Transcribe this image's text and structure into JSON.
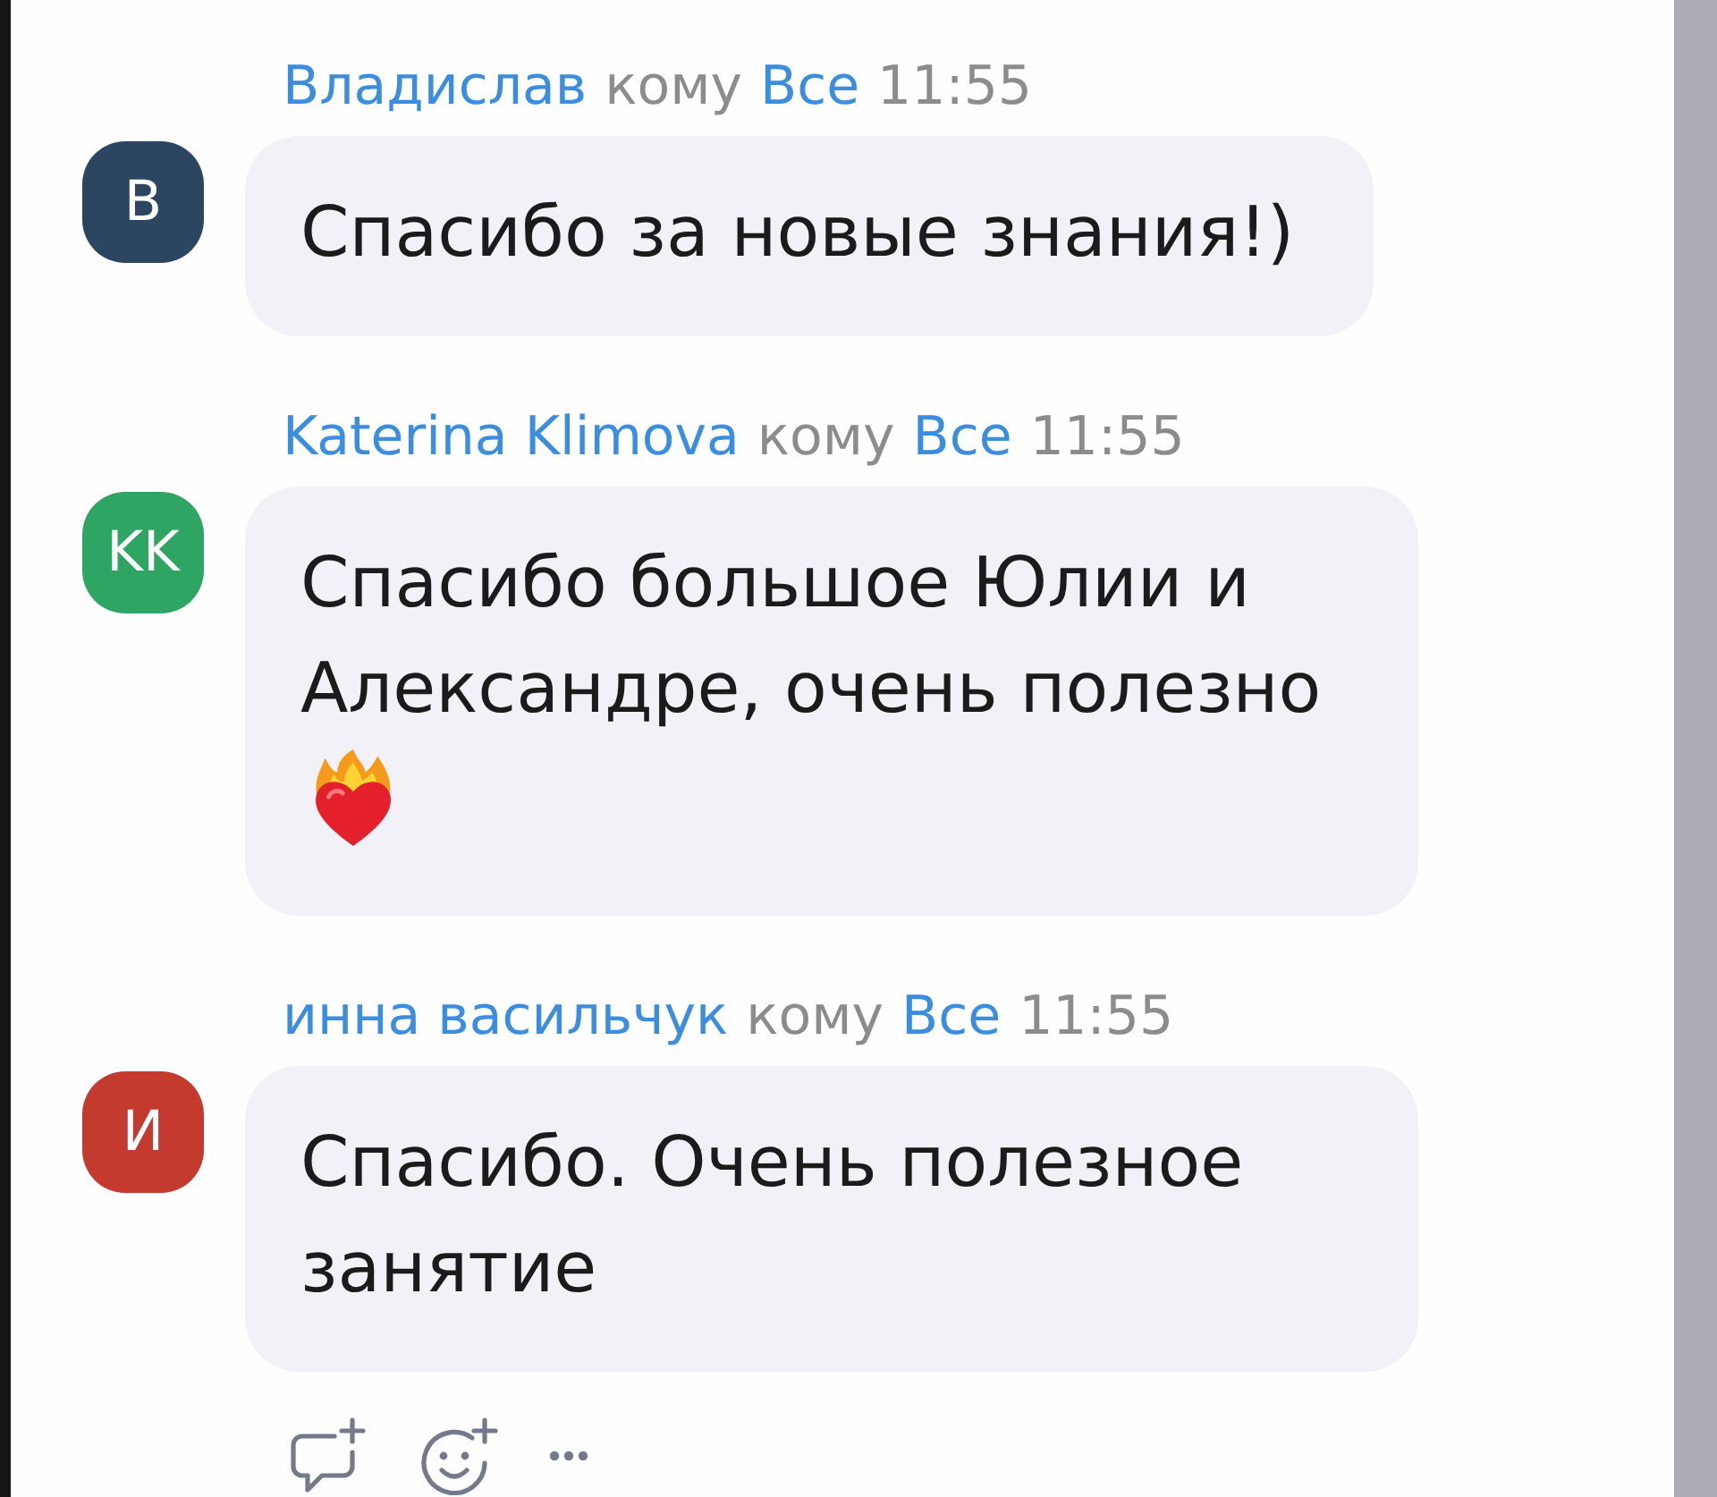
{
  "messages": [
    {
      "sender": "Владислав",
      "to_label": "кому",
      "recipient": "Все",
      "time": "11:55",
      "avatar": {
        "initials": "В",
        "color": "#2c4561"
      },
      "text": "Спасибо за новые знания!)",
      "emoji": false,
      "actions_shown": false
    },
    {
      "sender": "Katerina Klimova",
      "to_label": "кому",
      "recipient": "Все",
      "time": "11:55",
      "avatar": {
        "initials": "KK",
        "color": "#2ea562"
      },
      "text": "Спасибо большое Юлии и Александре, очень полезно",
      "emoji": true,
      "actions_shown": false
    },
    {
      "sender": "инна васильчук",
      "to_label": "кому",
      "recipient": "Все",
      "time": "11:55",
      "avatar": {
        "initials": "И",
        "color": "#c43a2e"
      },
      "text": "Спасибо. Очень полезное занятие",
      "emoji": false,
      "actions_shown": true
    }
  ]
}
